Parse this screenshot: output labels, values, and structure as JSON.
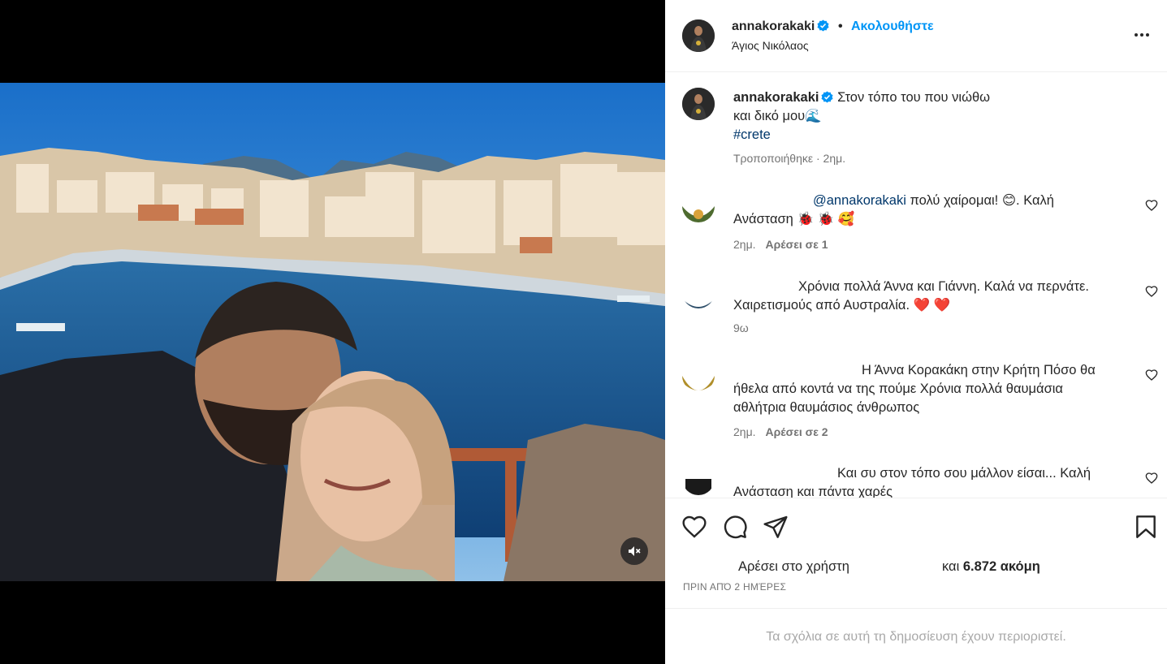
{
  "post": {
    "username": "annakorakaki",
    "verified": true,
    "separator_dot": "•",
    "follow_label": "Ακολουθήστε",
    "location": "Άγιος Νικόλαος",
    "caption_line1": "Στον τόπο του που νιώθω",
    "caption_line2": "και δικό μου",
    "caption_emoji": "🌊",
    "hashtag": "#crete",
    "caption_meta": "Τροποποιήθηκε · 2ημ."
  },
  "comments": [
    {
      "mention": "@annakorakaki",
      "text_line1": " πολύ χαίρομαι! 😊. Καλή",
      "text_line2": "Ανάσταση 🐞 🐞 🥰",
      "time": "2ημ.",
      "likes": "Αρέσει σε 1"
    },
    {
      "text_line1": "Χρόνια πολλά Άννα και Γιάννη. Καλά να περνάτε.",
      "text_line2": "Χαιρετισμούς από Αυστραλία. ❤️ ❤️",
      "time": "9ω"
    },
    {
      "text_line1": "Η Άννα Κορακάκη στην Κρήτη Πόσο θα",
      "text_line2": "ήθελα από κοντά να της πούμε Χρόνια πολλά θαυμάσια",
      "text_line3": "αθλήτρια θαυμάσιος άνθρωπος",
      "time": "2ημ.",
      "likes": "Αρέσει σε 2"
    },
    {
      "text_line1": "Και συ στον τόπο σου μάλλον είσαι... Καλή",
      "text_line2": "Ανάσταση και πάντα χαρές"
    }
  ],
  "actions": {
    "likes_prefix": "Αρέσει στο χρήστη",
    "likes_and": "και ",
    "likes_count": "6.872 ακόμη",
    "post_time": "ΠΡΙΝ ΑΠΌ 2 ΗΜΈΡΕΣ"
  },
  "comments_disabled": "Τα σχόλια σε αυτή τη δημοσίευση έχουν περιοριστεί.",
  "icons": {
    "verified": "verified-badge-icon",
    "more": "more-options-icon",
    "like": "heart-icon",
    "comment": "comment-bubble-icon",
    "share": "paper-plane-icon",
    "save": "bookmark-icon",
    "mute": "speaker-muted-icon"
  },
  "colors": {
    "accent": "#0095f6",
    "verified": "#0095f6",
    "text": "#262626",
    "secondary": "#737373",
    "link": "#00376b",
    "heart_red": "#e0245e"
  }
}
